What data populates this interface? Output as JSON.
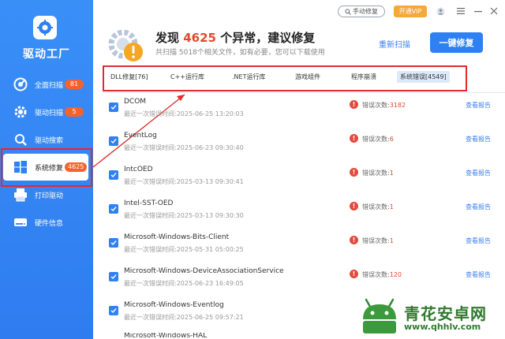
{
  "sidebar": {
    "app_name": "驱动工厂",
    "items": [
      {
        "label": "全面扫描",
        "badge": "81"
      },
      {
        "label": "驱动扫描",
        "badge": "5"
      },
      {
        "label": "驱动搜索",
        "badge": ""
      },
      {
        "label": "系统修复",
        "badge": "4625"
      },
      {
        "label": "打印驱动",
        "badge": ""
      },
      {
        "label": "硬件信息",
        "badge": ""
      }
    ]
  },
  "topbar": {
    "manual_repair": "手动修复",
    "vip": "开通VIP"
  },
  "header": {
    "title_prefix": "发现",
    "title_count": "4625",
    "title_suffix": "个异常，建议修复",
    "subtitle": "共扫描 5018个相关文件，如有必要，您可以下载使用",
    "rescan": "重新扫描",
    "repair_all": "一键修复"
  },
  "tabs": [
    {
      "label": "DLL修复[76]"
    },
    {
      "label": "C++运行库"
    },
    {
      "label": ".NET运行库"
    },
    {
      "label": "游戏组件"
    },
    {
      "label": "程序崩溃"
    },
    {
      "label": "系统错误[4549]"
    }
  ],
  "rows": [
    {
      "name": "DCOM",
      "time": "最近一次错误时间:2025-06-25 13:20:03",
      "error_label": "错误次数:",
      "error_count": "3182",
      "report": "查看报告"
    },
    {
      "name": "EventLog",
      "time": "最近一次错误时间:2025-06-23 09:30:40",
      "error_label": "错误次数:",
      "error_count": "6",
      "report": "查看报告"
    },
    {
      "name": "IntcOED",
      "time": "最近一次错误时间:2025-03-13 09:30:41",
      "error_label": "错误次数:",
      "error_count": "1",
      "report": "查看报告"
    },
    {
      "name": "Intel-SST-OED",
      "time": "最近一次错误时间:2025-03-13 09:30:30",
      "error_label": "错误次数:",
      "error_count": "1",
      "report": "查看报告"
    },
    {
      "name": "Microsoft-Windows-Bits-Client",
      "time": "最近一次错误时间:2025-05-31 05:00:25",
      "error_label": "错误次数:",
      "error_count": "1",
      "report": "查看报告"
    },
    {
      "name": "Microsoft-Windows-DeviceAssociationService",
      "time": "最近一次错误时间:2025-06-23 16:49:05",
      "error_label": "错误次数:",
      "error_count": "120",
      "report": "查看报告"
    },
    {
      "name": "Microsoft-Windows-Eventlog",
      "time": "最近一次错误时间:2025-06-25 09:57:21",
      "error_label": "",
      "error_count": "",
      "report": ""
    },
    {
      "name": "Microsoft-Windows-HAL",
      "time": "",
      "error_label": "",
      "error_count": "",
      "report": ""
    }
  ],
  "watermark": {
    "title": "青花安卓网",
    "url": "www.qhhlv.com"
  },
  "colors": {
    "sidebar_blue": "#3a8ff7",
    "accent_blue": "#2f80f2",
    "badge_orange": "#f5622d",
    "error_red": "#e24a3b",
    "highlight_red": "#e02b2b",
    "vip_orange": "#f4a93a",
    "watermark_green": "#2f7a2f"
  }
}
